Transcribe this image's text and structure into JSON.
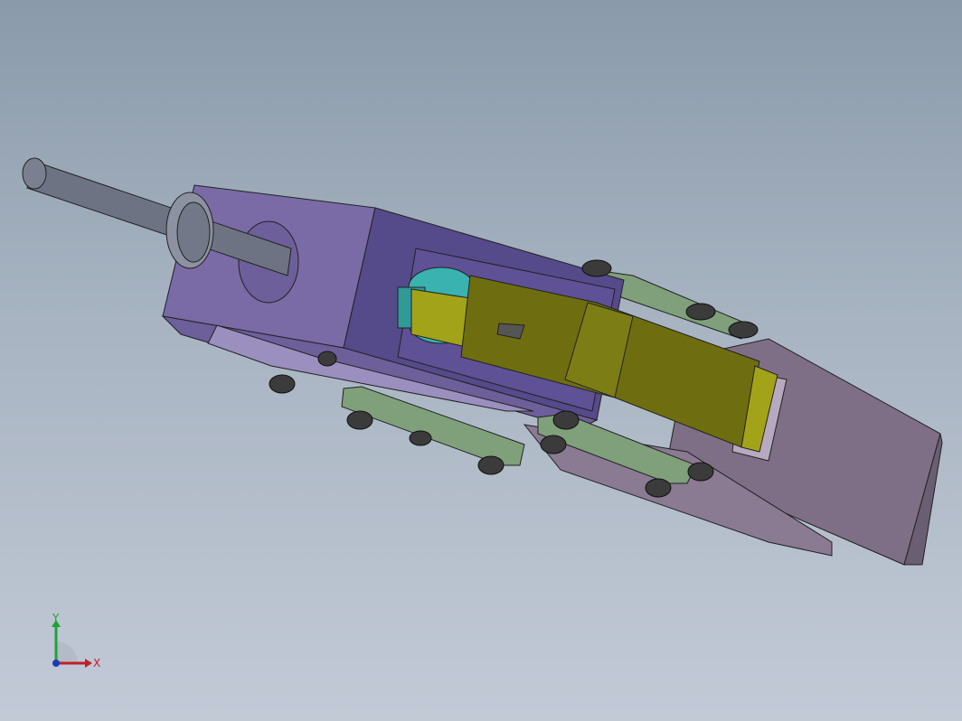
{
  "viewport": {
    "background_top": "#8a9aaa",
    "background_bottom": "#c2cad6"
  },
  "model": {
    "body_color": "#7a6aa6",
    "body_side_color": "#554a8a",
    "arm_color": "#7f6f86",
    "lever_color": "#6e6e10",
    "lever_light_color": "#a3a31a",
    "link_color": "#7fa07a",
    "pin_color": "#39b2b0",
    "shaft_color": "#6e7384",
    "fastener_color": "#3b3b3b"
  },
  "triad": {
    "x_label": "X",
    "y_label": "Y",
    "x_color": "#c0202a",
    "y_color": "#1fa23a",
    "z_color": "#1a3ab8"
  }
}
